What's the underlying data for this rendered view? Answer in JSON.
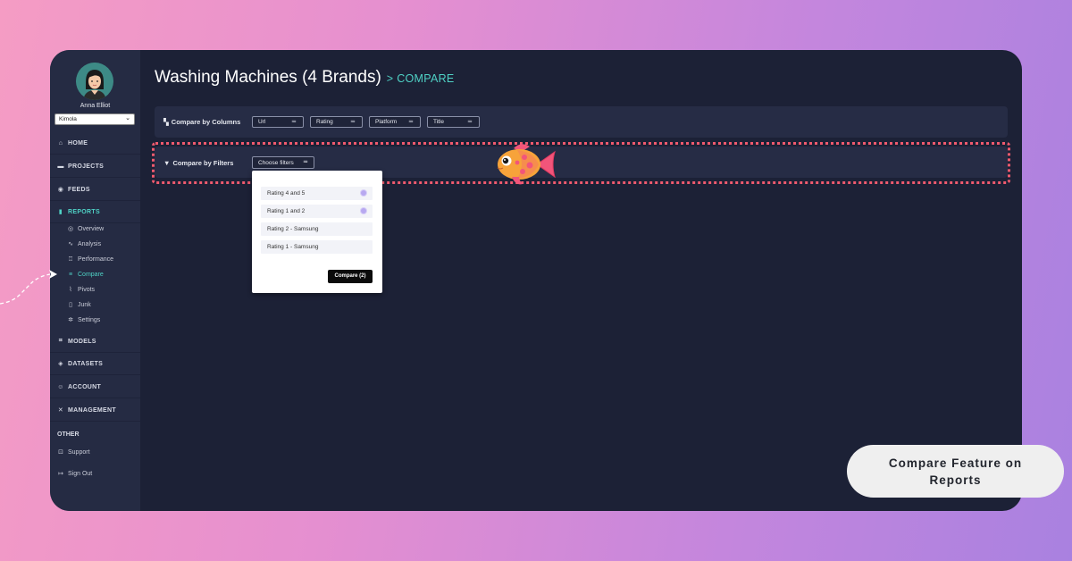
{
  "user": {
    "name": "Anna Elliot",
    "org": "Kimola"
  },
  "nav": {
    "home": "HOME",
    "projects": "PROJECTS",
    "feeds": "FEEDS",
    "reports": "REPORTS",
    "report_items": [
      "Overview",
      "Analysis",
      "Performance",
      "Compare",
      "Pivots",
      "Junk",
      "Settings"
    ],
    "models": "MODELS",
    "datasets": "DATASETS",
    "account": "ACCOUNT",
    "management": "MANAGEMENT",
    "other": "OTHER",
    "support": "Support",
    "signout": "Sign Out"
  },
  "header": {
    "title": "Washing Machines (4 Brands)",
    "crumb": "COMPARE"
  },
  "columns_panel": {
    "label": "Compare by Columns",
    "filters": [
      "Url",
      "Rating",
      "Platform",
      "Title"
    ]
  },
  "filters_panel": {
    "label": "Compare by Filters",
    "choose_label": "Choose filters",
    "options": [
      {
        "label": "Rating 4 and 5",
        "selected": true
      },
      {
        "label": "Rating 1 and 2",
        "selected": true
      },
      {
        "label": "Rating 2 - Samsung",
        "selected": false
      },
      {
        "label": "Rating 1 - Samsung",
        "selected": false
      }
    ],
    "compare_button": "Compare (2)"
  },
  "badge": {
    "line1": "Compare Feature on",
    "line2": "Reports"
  },
  "colors": {
    "accent": "#4fd1c5",
    "highlight": "#f05a6e",
    "panel": "#1c2136"
  }
}
